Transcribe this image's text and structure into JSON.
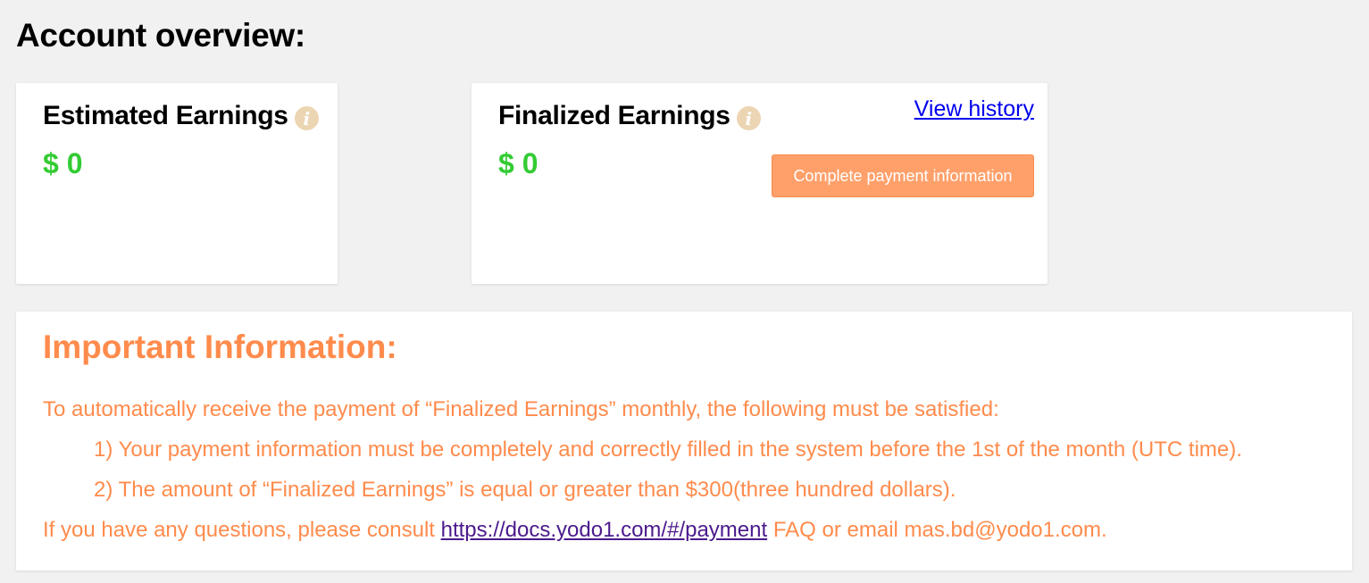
{
  "page": {
    "title": "Account overview:"
  },
  "estimated": {
    "title": "Estimated Earnings",
    "info_icon": "info-circle-icon",
    "amount": "$ 0"
  },
  "finalized": {
    "title": "Finalized Earnings",
    "info_icon": "info-circle-icon",
    "amount": "$ 0",
    "view_history_label": "View history",
    "complete_payment_label": "Complete payment information"
  },
  "important": {
    "title": "Important Information:",
    "line1": "To automatically receive the payment of “Finalized Earnings” monthly, the following must be satisfied:",
    "line2": "1) Your payment information must be completely and correctly filled in the system before the 1st of the month (UTC time).",
    "line3": "2) The amount of “Finalized Earnings” is equal or greater than $300(three hundred dollars).",
    "line4_prefix": "If you have any questions, please consult ",
    "docs_link": "https://docs.yodo1.com/#/payment",
    "line4_suffix": " FAQ or email mas.bd@yodo1.com."
  },
  "colors": {
    "page_background": "#f1f1f1",
    "amount_green": "#33cc33",
    "accent_orange": "#ff8b4c",
    "button_orange": "#ffa06a",
    "info_icon_beige": "#ecd5b3",
    "link_blue": "#0000ee",
    "visited_link_purple": "#4b1a8c"
  }
}
